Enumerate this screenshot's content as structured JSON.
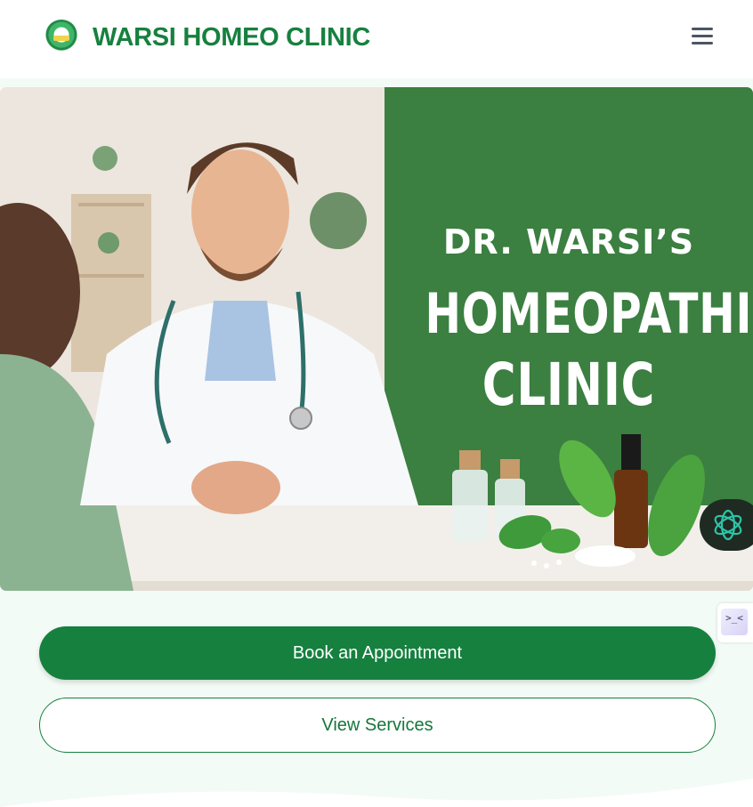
{
  "header": {
    "brand": "WARSI HOMEO CLINIC",
    "logo_icon": "clinic-logo-icon",
    "menu_icon": "hamburger-menu-icon"
  },
  "hero": {
    "line1": "DR. WARSI’S",
    "line2": "HOMEOPATHIC",
    "line3": "CLINIC",
    "panel_color": "#3b7f41"
  },
  "actions": {
    "primary_label": "Book an Appointment",
    "secondary_label": "View Services"
  },
  "widgets": {
    "ai_chat_icon": "ai-assistant-icon",
    "side_tab_icon": "code-icon",
    "side_tab_text": ">_<"
  },
  "colors": {
    "brand_green": "#17803f",
    "background": "#f3fbf6"
  }
}
